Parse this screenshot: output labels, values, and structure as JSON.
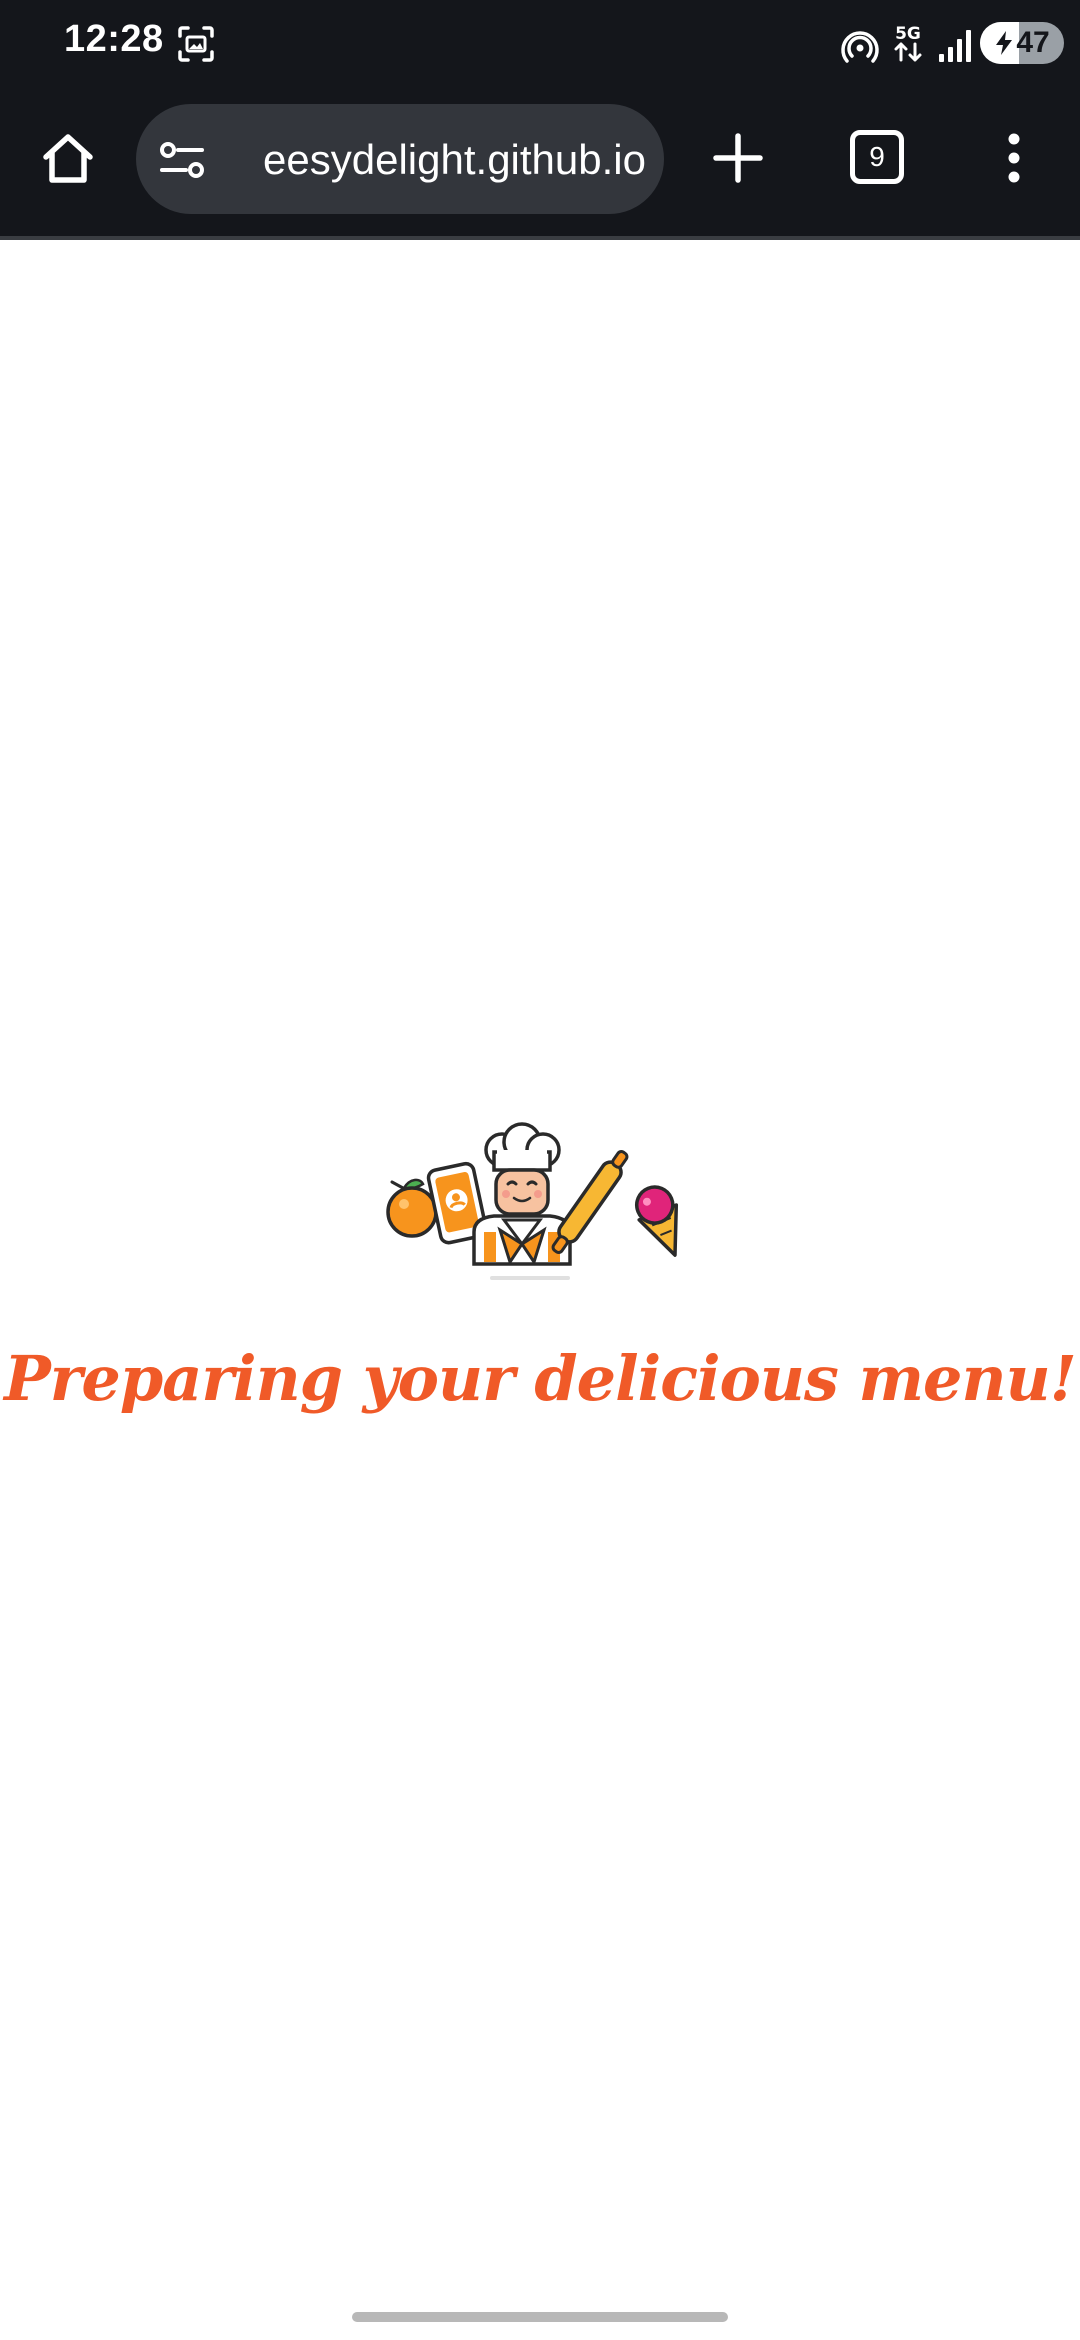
{
  "status_bar": {
    "time": "12:28",
    "network": "5G",
    "battery_level": "47",
    "battery_fraction": 0.47
  },
  "browser": {
    "url": "eesydelight.github.io",
    "tab_count": "9"
  },
  "page": {
    "loading_message": "Preparing your delicious menu!"
  },
  "colors": {
    "chrome_background": "#14161b",
    "omnibox_background": "#33363c",
    "accent_orange": "#f05a28",
    "page_background": "#ffffff"
  },
  "icons": {
    "home": "home-icon",
    "site_settings": "tune-icon",
    "new_tab": "plus-icon",
    "tab_switcher": "tab-count-icon",
    "menu": "more-vert-icon",
    "screenshot": "screenshot-icon",
    "hotspot": "hotspot-icon",
    "signal": "signal-icon",
    "battery_charging": "bolt-icon"
  }
}
